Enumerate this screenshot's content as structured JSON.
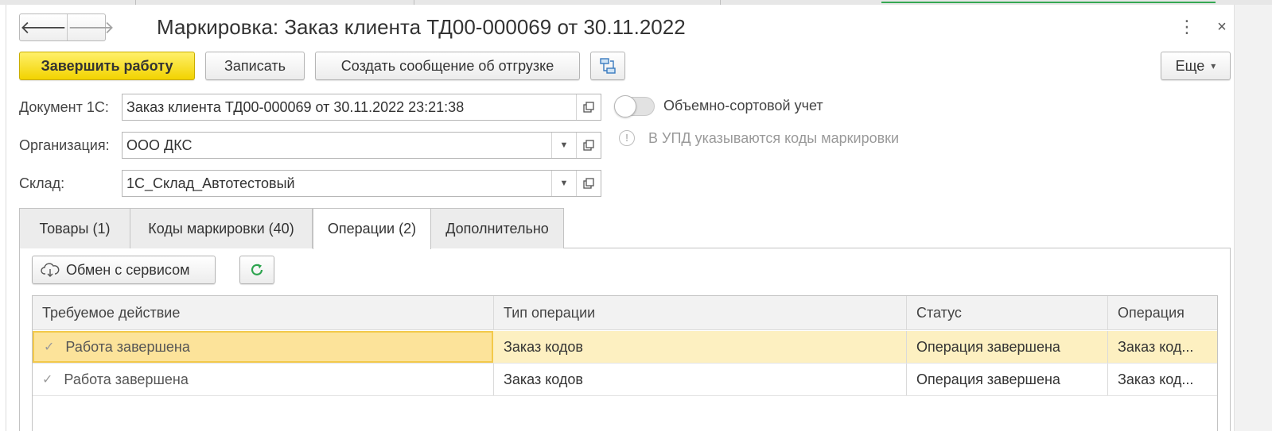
{
  "window": {
    "title": "Маркировка: Заказ клиента ТД00-000069 от 30.11.2022",
    "nav_back": "🡐",
    "nav_forward": "🡒",
    "more_menu": "⋮",
    "close": "×"
  },
  "toolbar": {
    "finish_label": "Завершить работу",
    "save_label": "Записать",
    "shipment_label": "Создать сообщение об отгрузке",
    "structure_icon": "structure-icon",
    "more_label": "Еще",
    "more_arrow": "▾"
  },
  "form": {
    "doc_label": "Документ 1С:",
    "doc_value": "Заказ клиента ТД00-000069 от 30.11.2022 23:21:38",
    "org_label": "Организация:",
    "org_value": "ООО ДКС",
    "warehouse_label": "Склад:",
    "warehouse_value": "1С_Склад_Автотестовый",
    "toggle_label": "Объемно-сортовой учет",
    "toggle_on": false,
    "info_text": "В УПД указываются коды маркировки"
  },
  "tabs": [
    {
      "label": "Товары (1)",
      "active": false
    },
    {
      "label": "Коды маркировки (40)",
      "active": false
    },
    {
      "label": "Операции (2)",
      "active": true
    },
    {
      "label": "Дополнительно",
      "active": false
    }
  ],
  "operations": {
    "exchange_label": "Обмен с сервисом",
    "refresh_icon": "refresh-icon",
    "columns": [
      "Требуемое действие",
      "Тип операции",
      "Статус",
      "Операция"
    ],
    "rows": [
      {
        "action": "Работа завершена",
        "type": "Заказ кодов",
        "status": "Операция завершена",
        "operation": "Заказ код...",
        "selected": true
      },
      {
        "action": "Работа завершена",
        "type": "Заказ кодов",
        "status": "Операция завершена",
        "operation": "Заказ код...",
        "selected": false
      }
    ]
  },
  "colors": {
    "primary_button": "#f2d300",
    "selected_row": "#fdf0c1",
    "refresh_icon": "#2ea44f"
  }
}
